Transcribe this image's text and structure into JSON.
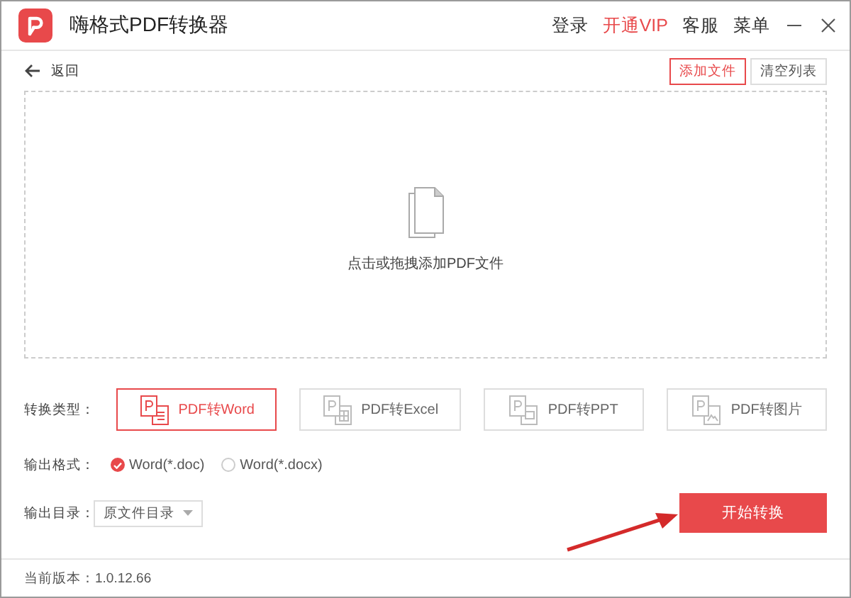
{
  "app": {
    "title": "嗨格式PDF转换器"
  },
  "header_menu": [
    {
      "label": "登录",
      "highlight": false
    },
    {
      "label": "开通VIP",
      "highlight": true
    },
    {
      "label": "客服",
      "highlight": false
    },
    {
      "label": "菜单",
      "highlight": false
    }
  ],
  "back": "返回",
  "toolbar": [
    {
      "label": "添加文件",
      "primary": true
    },
    {
      "label": "清空列表",
      "primary": false
    }
  ],
  "drop_zone": {
    "hint": "点击或拖拽添加PDF文件"
  },
  "conversion": {
    "label": "转换类型：",
    "options": [
      {
        "label": "PDF转Word",
        "kind": "word",
        "selected": true
      },
      {
        "label": "PDF转Excel",
        "kind": "excel",
        "selected": false
      },
      {
        "label": "PDF转PPT",
        "kind": "ppt",
        "selected": false
      },
      {
        "label": "PDF转图片",
        "kind": "image",
        "selected": false
      }
    ]
  },
  "format": {
    "label": "输出格式：",
    "options": [
      {
        "label": "Word(*.doc)",
        "selected": true
      },
      {
        "label": "Word(*.docx)",
        "selected": false
      }
    ]
  },
  "directory": {
    "label": "输出目录：",
    "value": "原文件目录"
  },
  "start_button": "开始转换",
  "status_bar": "当前版本：1.0.12.66"
}
